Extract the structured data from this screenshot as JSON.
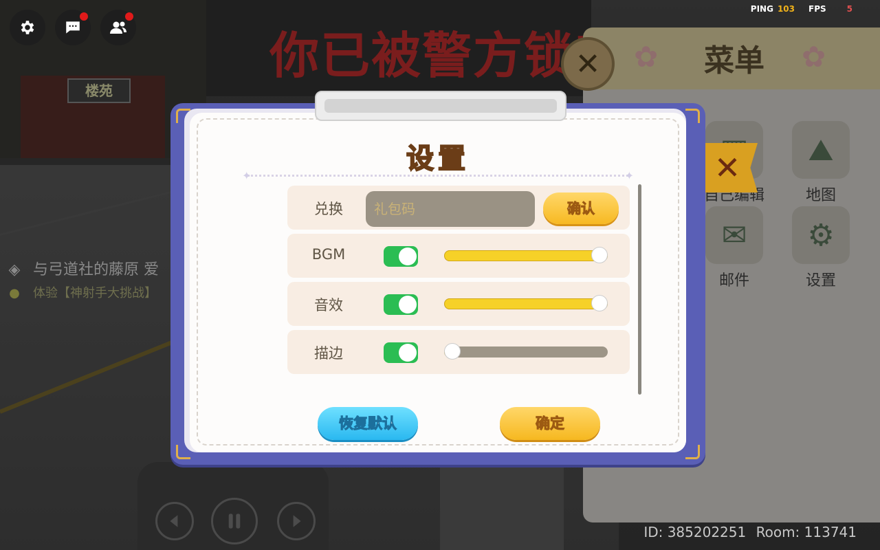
{
  "hud": {
    "ping_label": "PING",
    "ping_value": "103",
    "fps_label": "FPS",
    "fps_value": "5"
  },
  "scene": {
    "banner": "你已被警方锁定",
    "shop_sign": "楼苑",
    "quest_title": "与弓道社的藤原 爱",
    "quest_sub": "体验【神射手大挑战】"
  },
  "menu": {
    "title": "菜单",
    "items": [
      {
        "label": "自己编辑",
        "icon": "wardrobe-icon"
      },
      {
        "label": "地图",
        "icon": "map-icon"
      },
      {
        "label": "邮件",
        "icon": "mail-icon"
      },
      {
        "label": "设置",
        "icon": "gear-icon"
      }
    ]
  },
  "settings": {
    "title": "设置",
    "redeem": {
      "label": "兑换",
      "placeholder": "礼包码",
      "button": "确认"
    },
    "rows": [
      {
        "label": "BGM",
        "enabled": true,
        "level": 1.0
      },
      {
        "label": "音效",
        "enabled": true,
        "level": 1.0
      },
      {
        "label": "描边",
        "enabled": true,
        "level": 0.05
      }
    ],
    "reset_button": "恢复默认",
    "confirm_button": "确定"
  },
  "footer": {
    "id_text": "ID: 385202251",
    "room_text": "Room: 113741"
  },
  "colors": {
    "accent_yellow": "#f7b922",
    "accent_blue": "#2ab8f0",
    "toggle_on": "#2bbd53",
    "dialog_frame": "#5a5fb6"
  }
}
